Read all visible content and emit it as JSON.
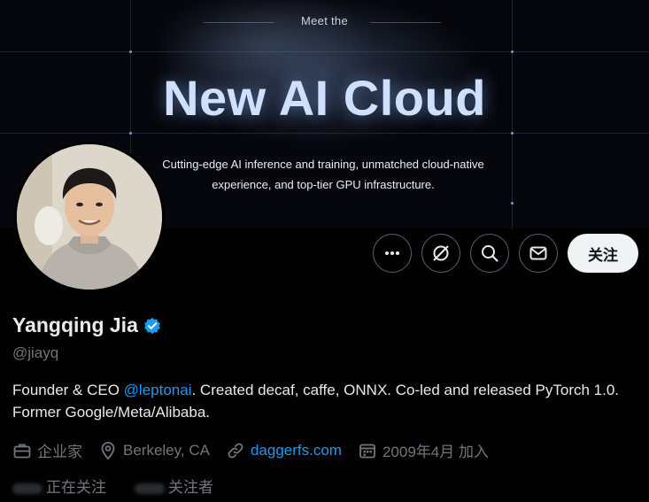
{
  "banner": {
    "meet_text": "Meet the",
    "headline": "New AI Cloud",
    "subline": "Cutting-edge AI inference and training, unmatched cloud-native experience, and top-tier GPU infrastructure."
  },
  "actions": {
    "more_icon": "more-horizontal-icon",
    "grok_icon": "grok-icon",
    "search_icon": "search-icon",
    "message_icon": "envelope-icon",
    "follow_label": "关注"
  },
  "profile": {
    "name": "Yangqing Jia",
    "verified": true,
    "handle": "@jiayq",
    "bio_prefix": "Founder & CEO ",
    "bio_mention": "@leptonai",
    "bio_suffix": ". Created decaf, caffe, ONNX. Co-led and released PyTorch 1.0. Former Google/Meta/Alibaba.",
    "category": "企业家",
    "location": "Berkeley, CA",
    "website": "daggerfs.com",
    "joined": "2009年4月 加入",
    "following_label": "正在关注",
    "followers_label": "关注者"
  },
  "colors": {
    "accent": "#1d9bf0",
    "muted": "#71767b",
    "text": "#e7e9ea",
    "background": "#000000"
  }
}
